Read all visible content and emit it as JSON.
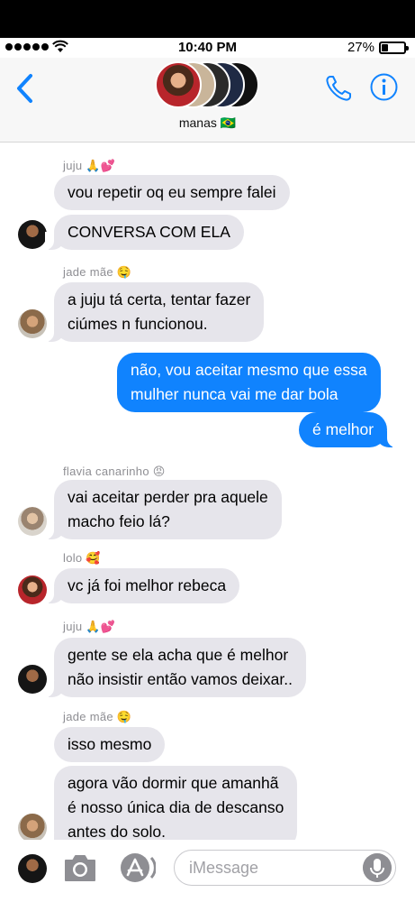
{
  "status": {
    "time": "10:40 PM",
    "battery": "27%"
  },
  "header": {
    "group_name": "manas 🇧🇷"
  },
  "messages": [
    {
      "sender": "juju 🙏💕",
      "text": "vou repetir oq eu sempre falei"
    },
    {
      "text": "CONVERSA COM ELA"
    },
    {
      "sender": "jade mãe 🤤",
      "text": "a juju tá certa, tentar fazer\nciúmes n funcionou."
    },
    {
      "text": "não, vou aceitar mesmo que essa\nmulher nunca vai me dar bola"
    },
    {
      "text": "é melhor"
    },
    {
      "sender": "flavia canarinho 😡",
      "text": "vai aceitar perder pra aquele\nmacho feio lá?"
    },
    {
      "sender": "lolo 🥰",
      "text": "vc já foi melhor rebeca"
    },
    {
      "sender": "juju 🙏💕",
      "text": "gente se ela acha que é melhor\nnão insistir então vamos deixar.."
    },
    {
      "sender": "jade mãe 🤤",
      "text": "isso mesmo"
    },
    {
      "text": "agora vão dormir que amanhã\né nosso única dia de descanso\nantes do solo."
    }
  ],
  "input": {
    "placeholder": "iMessage"
  },
  "colors": {
    "accent": "#1083fe",
    "incoming_bubble": "#e6e5eb"
  }
}
